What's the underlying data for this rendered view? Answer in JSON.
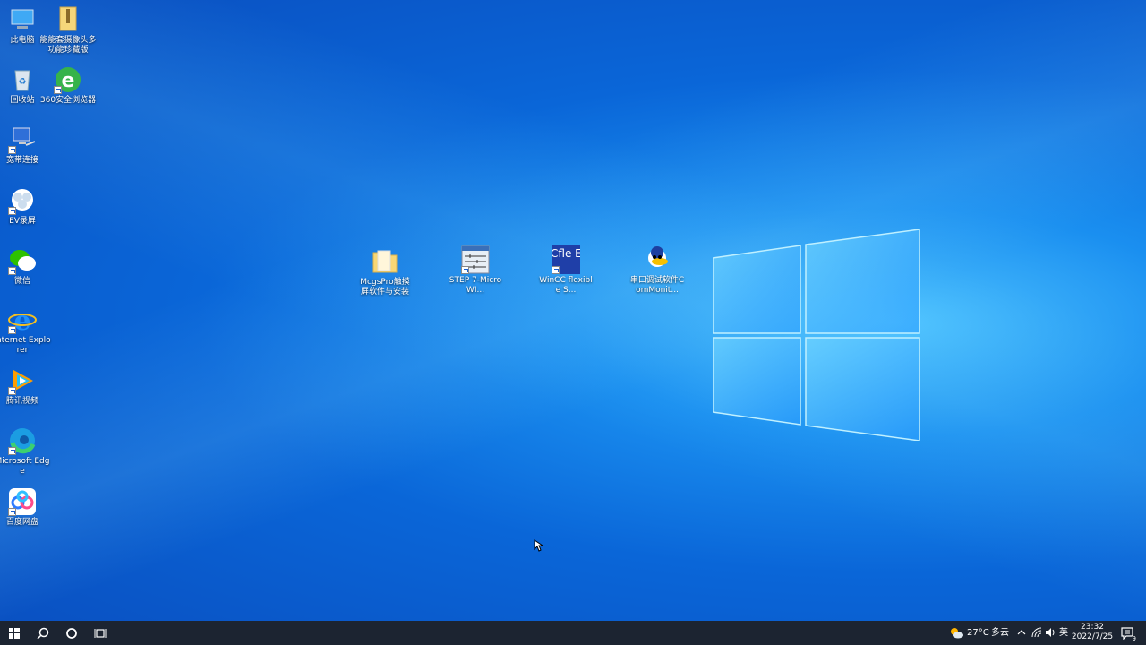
{
  "desktop_icons_left": [
    {
      "id": "this-pc",
      "label": "此电脑"
    },
    {
      "id": "recycle-bin",
      "label": "回收站"
    },
    {
      "id": "broadband",
      "label": "宽带连接"
    },
    {
      "id": "ev-recorder",
      "label": "EV录屏"
    },
    {
      "id": "wechat",
      "label": "微信"
    },
    {
      "id": "ie",
      "label": "Internet Explorer"
    },
    {
      "id": "tencent-video",
      "label": "腾讯视频"
    },
    {
      "id": "edge",
      "label": "Microsoft Edge"
    },
    {
      "id": "baidu-netdisk",
      "label": "百度网盘"
    }
  ],
  "desktop_icons_col2": [
    {
      "id": "camera-pack",
      "label": "能能套摄像头多功能珍藏版"
    },
    {
      "id": "browser-360",
      "label": "360安全浏览器"
    }
  ],
  "desktop_icons_center": [
    {
      "id": "mcgspro",
      "label": "McgsPro触摸屏软件与安装"
    },
    {
      "id": "step7",
      "label": "STEP 7-MicroWI..."
    },
    {
      "id": "wincc",
      "label": "WinCC flexible S..."
    },
    {
      "id": "commonitor",
      "label": "串口调试软件ComMonit..."
    }
  ],
  "wincc_icon_text": "CCfle ES",
  "taskbar": {
    "weather_temp": "27°C",
    "weather_desc": "多云",
    "ime": "英",
    "time": "23:32",
    "date": "2022/7/25",
    "notification_count": "9"
  },
  "colors": {
    "taskbar_bg": "#1c2431",
    "accent": "#0a66d8"
  }
}
